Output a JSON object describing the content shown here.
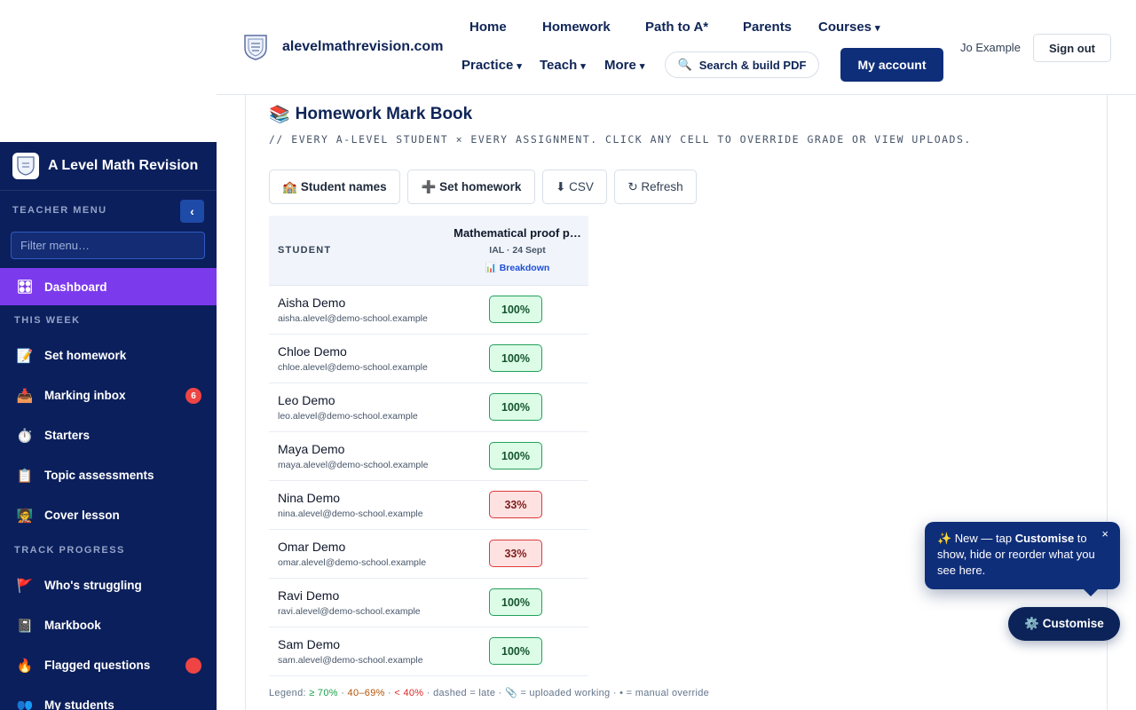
{
  "header": {
    "site_name": "alevelmathrevision.com",
    "nav": {
      "home": "Home",
      "homework": "Homework",
      "path": "Path to A*",
      "parents": "Parents",
      "courses": "Courses",
      "practice": "Practice",
      "teach": "Teach",
      "more": "More"
    },
    "search_label": "Search & build PDF",
    "account_label": "My account",
    "user_name": "Jo Example",
    "signout_label": "Sign out"
  },
  "sidebar": {
    "title": "A Level Math Revision",
    "menu_label": "TEACHER MENU",
    "collapse_glyph": "‹",
    "filter_placeholder": "Filter menu…",
    "dashboard": {
      "icon": "🎛",
      "label": "Dashboard"
    },
    "section_this_week": "THIS WEEK",
    "this_week": [
      {
        "icon": "📝",
        "label": "Set homework"
      },
      {
        "icon": "📥",
        "label": "Marking inbox",
        "badge": "6"
      },
      {
        "icon": "⏱️",
        "label": "Starters"
      },
      {
        "icon": "📋",
        "label": "Topic assessments"
      },
      {
        "icon": "🧑‍🏫",
        "label": "Cover lesson"
      }
    ],
    "section_track": "TRACK PROGRESS",
    "track": [
      {
        "icon": "🚩",
        "label": "Who's struggling"
      },
      {
        "icon": "📓",
        "label": "Markbook"
      },
      {
        "icon": "🔥",
        "label": "Flagged questions"
      },
      {
        "icon": "👥",
        "label": "My students"
      }
    ]
  },
  "page": {
    "icon": "📚",
    "title": "Homework Mark Book",
    "subtitle": "// EVERY A-LEVEL STUDENT × EVERY ASSIGNMENT. CLICK ANY CELL TO OVERRIDE GRADE OR VIEW UPLOADS.",
    "toolbar": {
      "student_names": "🏫 Student names",
      "set_homework": "➕ Set homework",
      "csv": "⬇ CSV",
      "refresh": "↻ Refresh"
    }
  },
  "table": {
    "student_header": "STUDENT",
    "assignment": {
      "title": "Mathematical proof p…",
      "meta": "IAL · 24 Sept",
      "breakdown": "📊 Breakdown"
    },
    "rows": [
      {
        "name": "Aisha Demo",
        "email": "aisha.alevel@demo-school.example",
        "grade": "100%",
        "status": "good"
      },
      {
        "name": "Chloe Demo",
        "email": "chloe.alevel@demo-school.example",
        "grade": "100%",
        "status": "good"
      },
      {
        "name": "Leo Demo",
        "email": "leo.alevel@demo-school.example",
        "grade": "100%",
        "status": "good"
      },
      {
        "name": "Maya Demo",
        "email": "maya.alevel@demo-school.example",
        "grade": "100%",
        "status": "good"
      },
      {
        "name": "Nina Demo",
        "email": "nina.alevel@demo-school.example",
        "grade": "33%",
        "status": "bad"
      },
      {
        "name": "Omar Demo",
        "email": "omar.alevel@demo-school.example",
        "grade": "33%",
        "status": "bad"
      },
      {
        "name": "Ravi Demo",
        "email": "ravi.alevel@demo-school.example",
        "grade": "100%",
        "status": "good"
      },
      {
        "name": "Sam Demo",
        "email": "sam.alevel@demo-school.example",
        "grade": "100%",
        "status": "good"
      }
    ]
  },
  "legend": {
    "prefix": "Legend:",
    "green": "≥ 70%",
    "amber": "40–69%",
    "red": "< 40%",
    "rest": "· dashed = late · 📎 = uploaded working · • = manual override"
  },
  "tip": {
    "text_before": "✨ New — tap ",
    "text_bold": "Customise",
    "text_after": " to show, hide or reorder what you see here.",
    "close": "×"
  },
  "customise_label": "⚙️ Customise",
  "colors": {
    "sidebar_bg": "#0b1f5c",
    "accent_active": "#7c3aed",
    "primary": "#0f2e7a",
    "good": "#dcfce7",
    "bad": "#fee2e2"
  }
}
